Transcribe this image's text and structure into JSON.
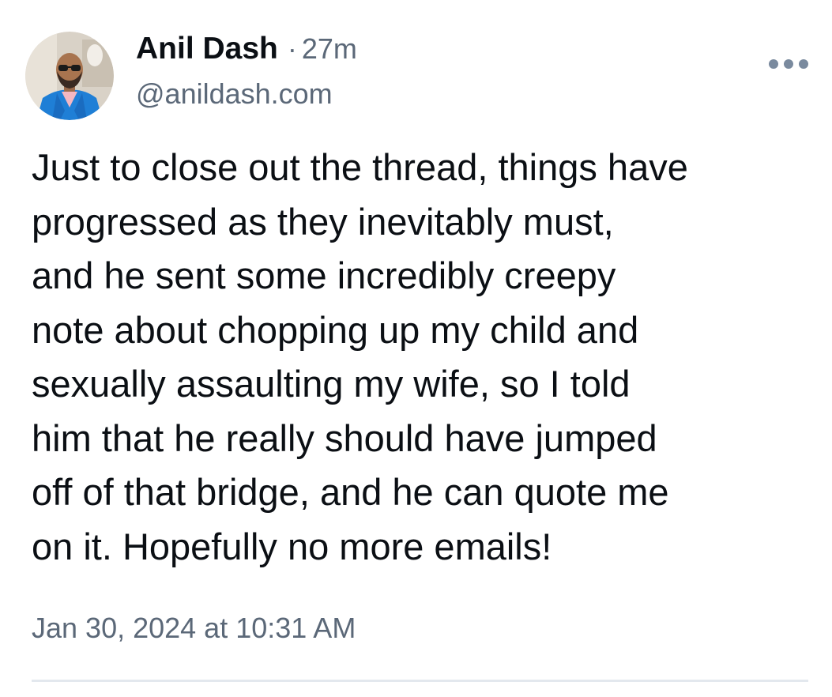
{
  "post": {
    "author": {
      "display_name": "Anil Dash",
      "handle": "@anildash.com",
      "avatar_icon": "user-avatar"
    },
    "separator": "·",
    "relative_time": "27m",
    "more_icon": "more-options-icon",
    "text": "Just to close out the thread, things have\nprogressed as they inevitably must,\nand he sent some incredibly creepy\nnote about chopping up my child and\nsexually assaulting my wife, so I told\nhim that he really should have jumped\noff of that bridge, and he can quote me\non it. Hopefully no more emails!",
    "timestamp": "Jan 30, 2024 at 10:31 AM"
  },
  "colors": {
    "text_primary": "#0b0f14",
    "text_secondary": "#5b6878",
    "icon_muted": "#7a8a9e",
    "divider": "#e3e8ee"
  }
}
